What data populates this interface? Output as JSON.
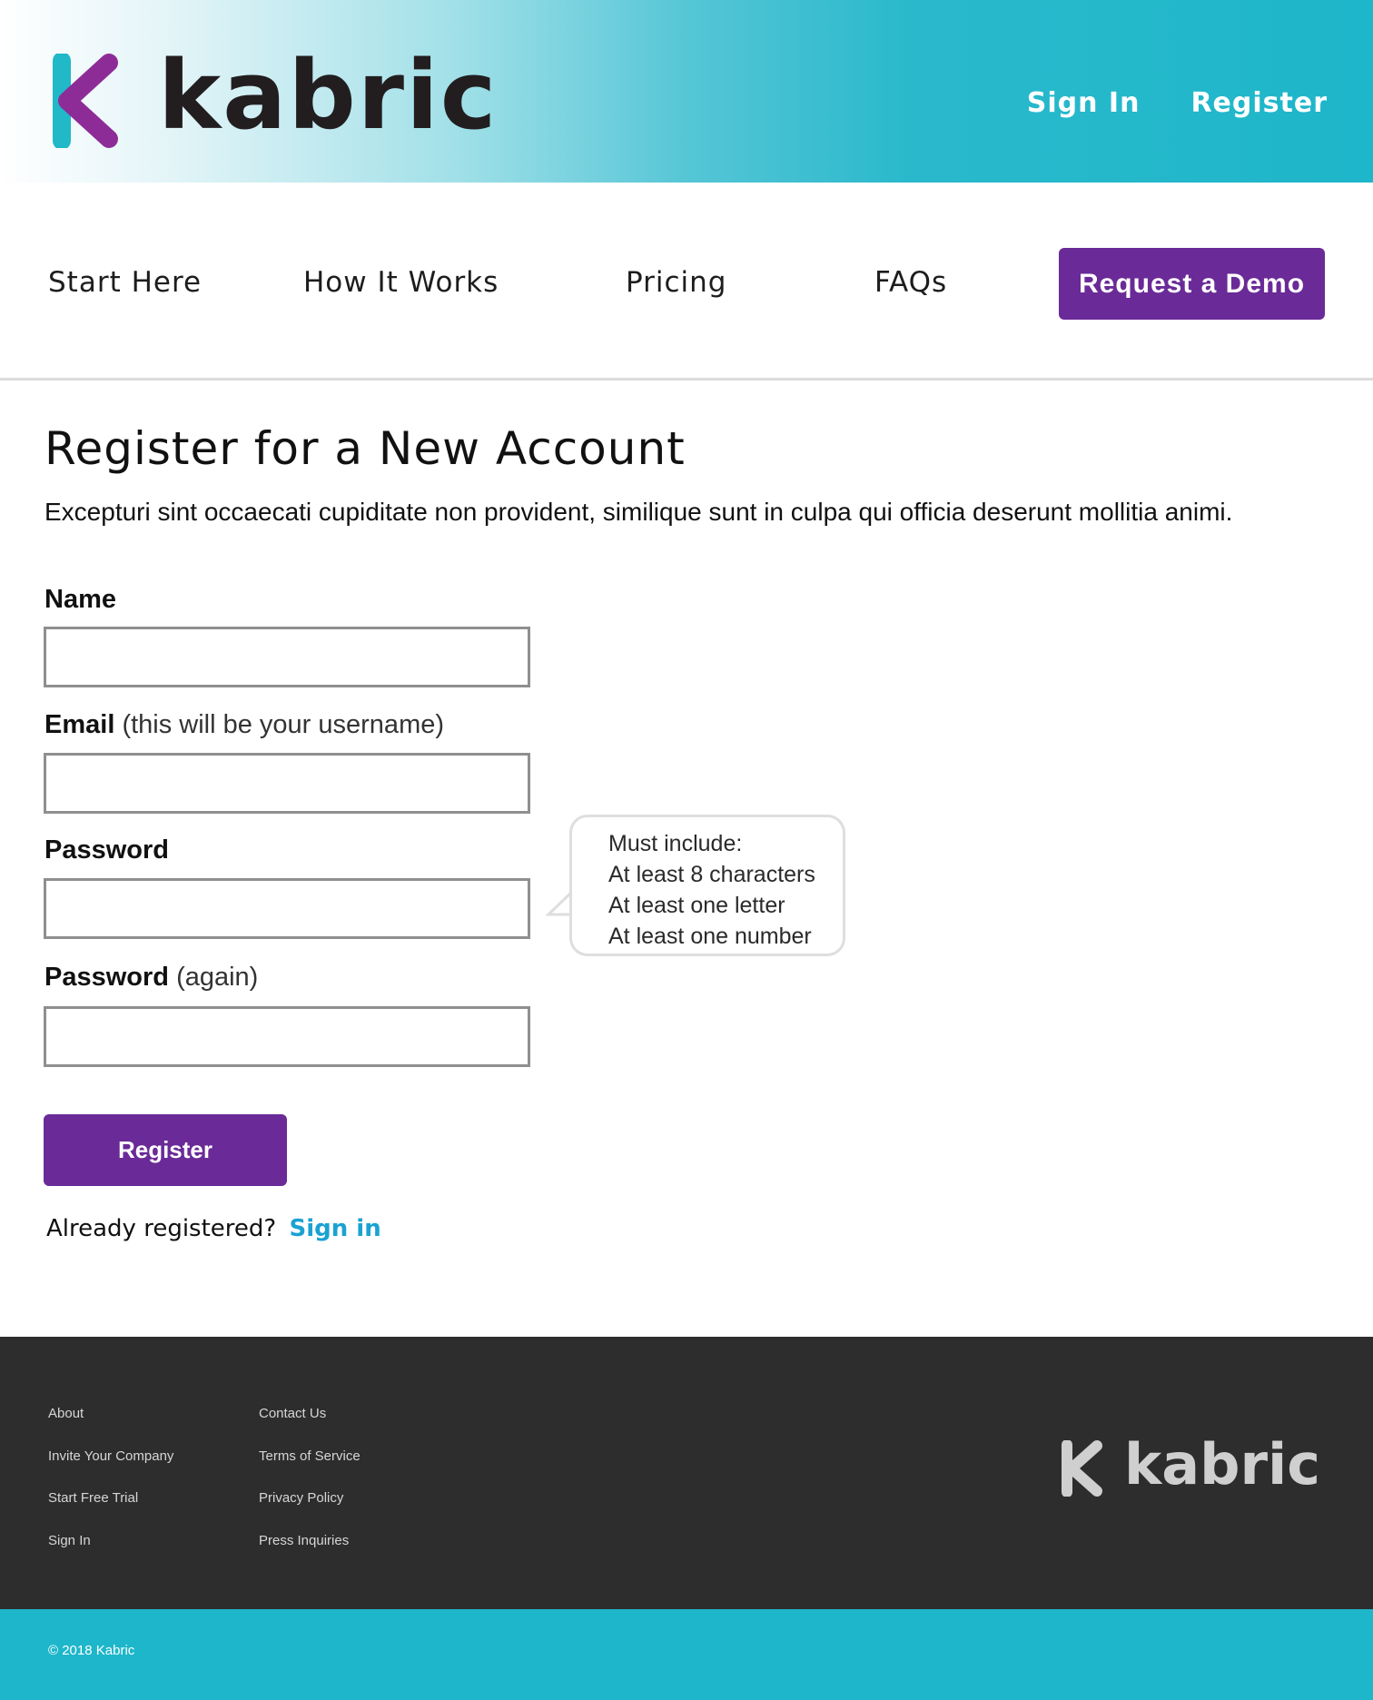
{
  "brand": {
    "name": "kabric",
    "colors": {
      "teal": "#1eb6ca",
      "purple": "#6a2a97",
      "mark_purple": "#8e2c97",
      "dark": "#2d2d2e",
      "link_blue": "#1aa2d2"
    }
  },
  "header": {
    "top_links": [
      "Sign In",
      "Register"
    ]
  },
  "nav": {
    "items": [
      "Start Here",
      "How It Works",
      "Pricing",
      "FAQs"
    ],
    "cta": "Request a Demo"
  },
  "main": {
    "title": "Register for a New Account",
    "intro": "Excepturi sint occaecati cupiditate non provident, similique sunt in culpa qui officia deserunt mollitia animi.",
    "fields": {
      "name": {
        "label": "Name",
        "value": ""
      },
      "email": {
        "label": "Email",
        "hint": "(this will be your username)",
        "value": ""
      },
      "password": {
        "label": "Password",
        "value": ""
      },
      "password_again": {
        "label": "Password",
        "hint": "(again)",
        "value": ""
      }
    },
    "password_tip": [
      "Must include:",
      "At least 8 characters",
      "At least one letter",
      "At least one number"
    ],
    "submit_label": "Register",
    "already_text": "Already registered?",
    "signin_link": "Sign in"
  },
  "footer": {
    "col1": [
      "About",
      "Invite Your Company",
      "Start Free Trial",
      "Sign In"
    ],
    "col2": [
      "Contact Us",
      "Terms of Service",
      "Privacy Policy",
      "Press Inquiries"
    ],
    "copyright": "© 2018 Kabric"
  }
}
